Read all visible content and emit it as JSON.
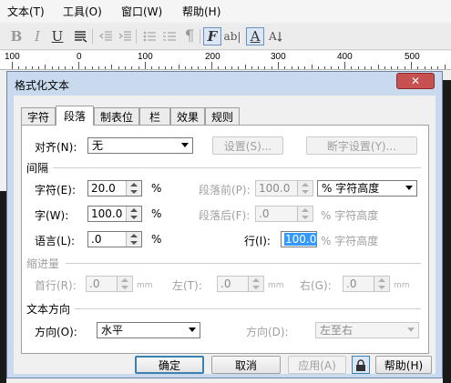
{
  "menubar": {
    "items": [
      "文本(T)",
      "工具(O)",
      "窗口(W)",
      "帮助(H)"
    ]
  },
  "toolbar": {
    "icons": [
      "bold-icon",
      "italic-icon",
      "underline-icon",
      "text-align-icon",
      "decrease-indent-icon",
      "increase-indent-icon",
      "bullet-list-icon",
      "numbered-list-icon",
      "paragraph-mark-icon",
      "format-text-icon",
      "text-edit-icon",
      "character-outline-icon",
      "vertical-text-icon"
    ]
  },
  "ruler": {
    "labels": [
      "100",
      "0",
      "100",
      "200",
      "300",
      "400",
      "500"
    ]
  },
  "dialog": {
    "title": "格式化文本",
    "close_label": "✕",
    "tabs": [
      "字符",
      "段落",
      "制表位",
      "栏",
      "效果",
      "规则"
    ],
    "active_tab": "段落",
    "align": {
      "label": "对齐(N):",
      "value": "无"
    },
    "settings_button": "设置(S)...",
    "hyphen_button": "断字设置(Y)...",
    "spacing": {
      "title": "间隔",
      "char": {
        "label": "字符(E):",
        "value": "20.0",
        "unit": "%"
      },
      "word": {
        "label": "字(W):",
        "value": "100.0",
        "unit": "%"
      },
      "lang": {
        "label": "语言(L):",
        "value": ".0",
        "unit": "%"
      },
      "before": {
        "label": "段落前(P):",
        "value": "100.0",
        "unit_value": "% 字符高度"
      },
      "after": {
        "label": "段落后(F):",
        "value": ".0",
        "unit": "% 字符高度"
      },
      "line": {
        "label": "行(I):",
        "value": "100.0",
        "unit": "% 字符高度"
      }
    },
    "indent": {
      "title": "缩进量",
      "first": {
        "label": "首行(R):",
        "value": ".0",
        "unit": "mm"
      },
      "left": {
        "label": "左(T):",
        "value": ".0",
        "unit": "mm"
      },
      "right": {
        "label": "右(G):",
        "value": ".0",
        "unit": "mm"
      }
    },
    "direction": {
      "title": "文本方向",
      "dir": {
        "label": "方向(O):",
        "value": "水平"
      },
      "dir2": {
        "label": "方向(D):",
        "value": "左至右"
      }
    },
    "buttons": {
      "ok": "确定",
      "cancel": "取消",
      "apply": "应用(A)",
      "help": "帮助(H)"
    }
  },
  "colors": {
    "titlebar": "#c9d9ee",
    "close": "#c75050",
    "selection": "#3399ff"
  }
}
